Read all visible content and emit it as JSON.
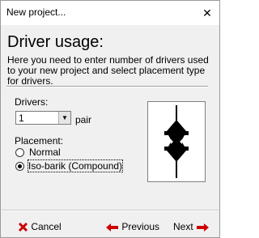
{
  "window": {
    "title": "New project...",
    "close_glyph": "✕"
  },
  "header": {
    "heading": "Driver usage:",
    "description": "Here you need to enter number of drivers used to your new project and select placement type for drivers."
  },
  "drivers": {
    "label": "Drivers:",
    "value": "1",
    "unit": "pair"
  },
  "placement": {
    "label": "Placement:",
    "options": [
      {
        "label": "Normal",
        "selected": false
      },
      {
        "label": "Iso-barik (Compound)",
        "selected": true
      }
    ]
  },
  "preview": {
    "icon": "driver-placement-preview"
  },
  "footer": {
    "cancel": "Cancel",
    "previous": "Previous",
    "next": "Next"
  },
  "colors": {
    "cancel_icon": "#cc0000",
    "arrow_icon": "#cc0000"
  }
}
